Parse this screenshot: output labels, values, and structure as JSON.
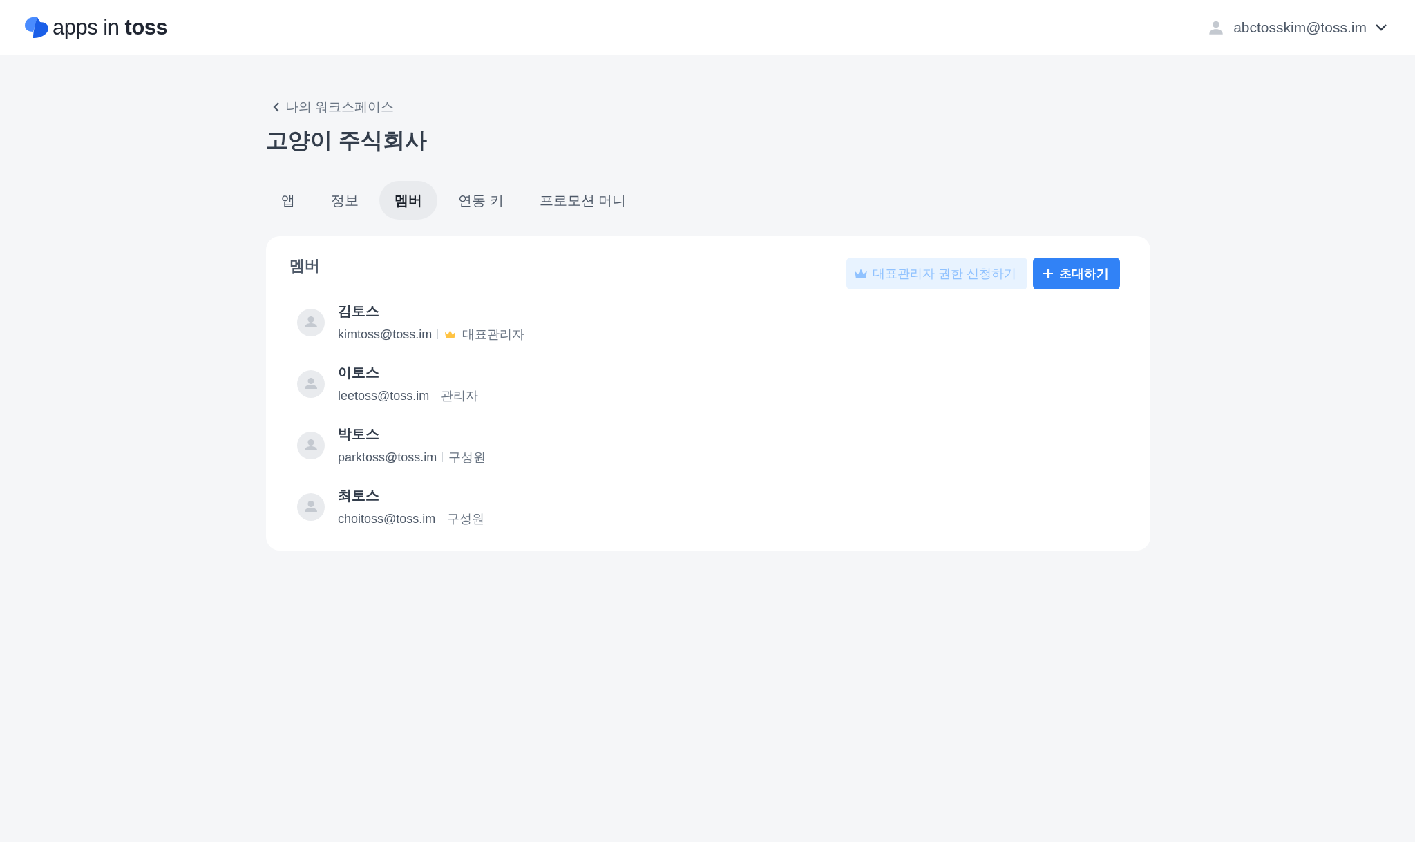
{
  "header": {
    "logo": "apps in **toss**",
    "account": "abctosskim@toss.im"
  },
  "back_link": "나의 워크스페이스",
  "title": "고양이 주식회사",
  "tabs": [
    {
      "label": "앱",
      "selected": false
    },
    {
      "label": "정보",
      "selected": false
    },
    {
      "label": "멤버",
      "selected": true
    },
    {
      "label": "연동 키",
      "selected": false
    },
    {
      "label": "프로모션 머니",
      "selected": false
    }
  ],
  "card": {
    "title": "멤버",
    "apply_button": "대표관리자 권한 신청하기",
    "invite_button": "초대하기",
    "members": [
      {
        "name": "김토스",
        "email": "kimtoss@toss.im",
        "role": "대표관리자",
        "crown": true
      },
      {
        "name": "이토스",
        "email": "leetoss@toss.im",
        "role": "관리자",
        "crown": false
      },
      {
        "name": "박토스",
        "email": "parktoss@toss.im",
        "role": "구성원",
        "crown": false
      },
      {
        "name": "최토스",
        "email": "choitoss@toss.im",
        "role": "구성원",
        "crown": false
      }
    ]
  }
}
